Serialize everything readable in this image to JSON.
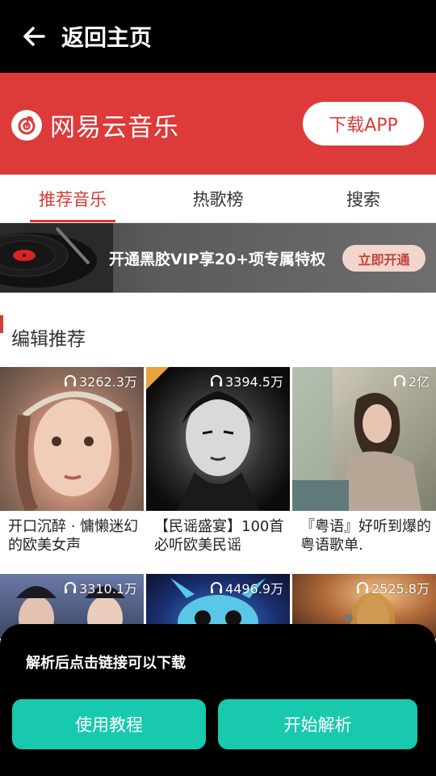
{
  "topbar": {
    "back_label": "返回主页"
  },
  "header": {
    "app_name": "网易云音乐",
    "download_label": "下载APP"
  },
  "tabs": [
    {
      "label": "推荐音乐",
      "active": true
    },
    {
      "label": "热歌榜",
      "active": false
    },
    {
      "label": "搜索",
      "active": false
    }
  ],
  "vip_banner": {
    "text": "开通黑胶VIP享20+项专属特权",
    "button_label": "立即开通"
  },
  "section": {
    "title": "编辑推荐"
  },
  "playlists": [
    {
      "title": "开口沉醉 · 慵懒迷幻的欧美女声",
      "plays": "3262.3万"
    },
    {
      "title": "【民谣盛宴】100首必听欧美民谣",
      "plays": "3394.5万"
    },
    {
      "title": "『粤语』好听到爆的粤语歌单.",
      "plays": "2亿"
    },
    {
      "title": "",
      "plays": "3310.1万"
    },
    {
      "title": "",
      "plays": "4496.9万"
    },
    {
      "title": "",
      "plays": "2525.8万"
    }
  ],
  "sheet": {
    "hint": "解析后点击链接可以下载",
    "tutorial_label": "使用教程",
    "parse_label": "开始解析"
  },
  "colors": {
    "brand_red": "#dd3a3a",
    "accent_teal": "#18c9ad"
  }
}
